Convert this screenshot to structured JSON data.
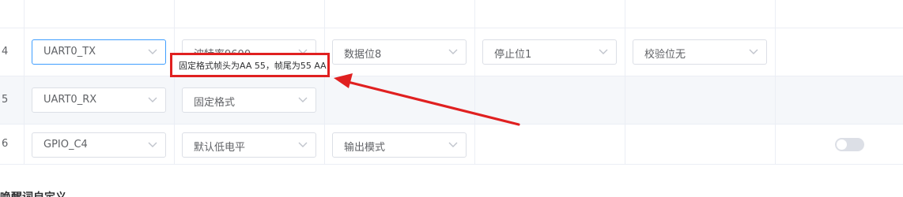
{
  "rows": [
    {
      "index": "4",
      "pin": "UART0_TX",
      "param1": "波特率9600",
      "param2": "数据位8",
      "param3": "停止位1",
      "param4": "校验位无"
    },
    {
      "index": "5",
      "pin": "UART0_RX",
      "param1": "固定格式"
    },
    {
      "index": "6",
      "pin": "GPIO_C4",
      "param1": "默认低电平",
      "param2": "输出模式",
      "toggle_on": false
    }
  ],
  "tooltip": {
    "text": "固定格式帧头为AA 55，帧尾为55 AA"
  },
  "section": {
    "title": "唤醒词自定义"
  },
  "colors": {
    "annotation": "#e02020",
    "focus_border": "#409eff",
    "row_hover": "#f5f7fa"
  }
}
